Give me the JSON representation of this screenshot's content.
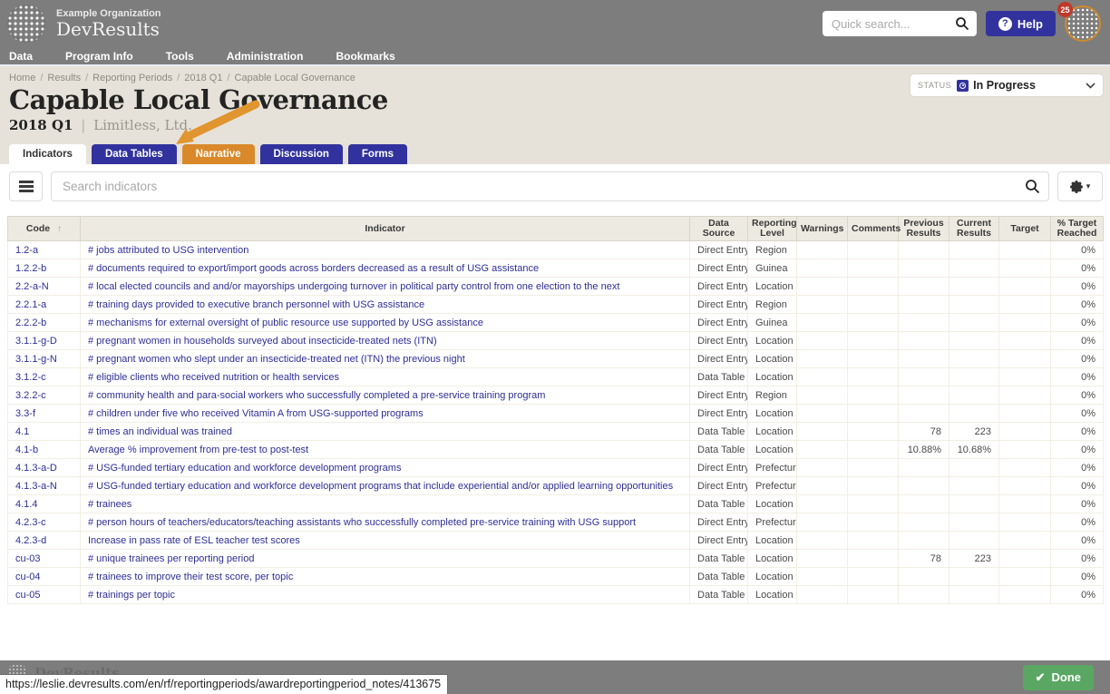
{
  "header": {
    "org_name": "Example Organization",
    "app_name": "DevResults",
    "quick_search_placeholder": "Quick search...",
    "help_label": "Help",
    "notification_count": "25"
  },
  "nav": {
    "items": [
      "Data",
      "Program Info",
      "Tools",
      "Administration",
      "Bookmarks"
    ]
  },
  "breadcrumb": {
    "items": [
      "Home",
      "Results",
      "Reporting Periods",
      "2018 Q1",
      "Capable Local Governance"
    ]
  },
  "page": {
    "title": "Capable Local Governance",
    "period": "2018 Q1",
    "partner": "Limitless, Ltd.",
    "status_label": "STATUS",
    "status_value": "In Progress"
  },
  "tabs": [
    {
      "label": "Indicators"
    },
    {
      "label": "Data Tables"
    },
    {
      "label": "Narrative"
    },
    {
      "label": "Discussion"
    },
    {
      "label": "Forms"
    }
  ],
  "toolbar": {
    "search_placeholder": "Search indicators"
  },
  "table": {
    "columns": [
      "Code",
      "Indicator",
      "Data Source",
      "Reporting Level",
      "Warnings",
      "Comments",
      "Previous Results",
      "Current Results",
      "Target",
      "% Target Reached"
    ],
    "rows": [
      {
        "code": "1.2-a",
        "indicator": "# jobs attributed to USG intervention",
        "data_source": "Direct Entry",
        "reporting_level": "Region",
        "warnings": "",
        "comments": "",
        "previous": "",
        "current": "",
        "target": "",
        "pct": "0%"
      },
      {
        "code": "1.2.2-b",
        "indicator": "# documents required to export/import goods across borders decreased as a result of USG assistance",
        "data_source": "Direct Entry",
        "reporting_level": "Guinea",
        "warnings": "",
        "comments": "",
        "previous": "",
        "current": "",
        "target": "",
        "pct": "0%"
      },
      {
        "code": "2.2-a-N",
        "indicator": "# local elected councils and and/or mayorships undergoing turnover in political party control from one election to the next",
        "data_source": "Direct Entry",
        "reporting_level": "Location",
        "warnings": "",
        "comments": "",
        "previous": "",
        "current": "",
        "target": "",
        "pct": "0%"
      },
      {
        "code": "2.2.1-a",
        "indicator": "# training days provided to executive branch personnel with USG assistance",
        "data_source": "Direct Entry",
        "reporting_level": "Region",
        "warnings": "",
        "comments": "",
        "previous": "",
        "current": "",
        "target": "",
        "pct": "0%"
      },
      {
        "code": "2.2.2-b",
        "indicator": "# mechanisms for external oversight of public resource use supported by USG assistance",
        "data_source": "Direct Entry",
        "reporting_level": "Guinea",
        "warnings": "",
        "comments": "",
        "previous": "",
        "current": "",
        "target": "",
        "pct": "0%"
      },
      {
        "code": "3.1.1-g-D",
        "indicator": "# pregnant women in households surveyed about insecticide-treated nets (ITN)",
        "data_source": "Direct Entry",
        "reporting_level": "Location",
        "warnings": "",
        "comments": "",
        "previous": "",
        "current": "",
        "target": "",
        "pct": "0%"
      },
      {
        "code": "3.1.1-g-N",
        "indicator": "# pregnant women who slept under an insecticide-treated net (ITN) the previous night",
        "data_source": "Direct Entry",
        "reporting_level": "Location",
        "warnings": "",
        "comments": "",
        "previous": "",
        "current": "",
        "target": "",
        "pct": "0%"
      },
      {
        "code": "3.1.2-c",
        "indicator": "# eligible clients who received nutrition or health services",
        "data_source": "Data Table",
        "reporting_level": "Location",
        "warnings": "",
        "comments": "",
        "previous": "",
        "current": "",
        "target": "",
        "pct": "0%"
      },
      {
        "code": "3.2.2-c",
        "indicator": "# community health and para-social workers who successfully completed a pre-service training program",
        "data_source": "Direct Entry",
        "reporting_level": "Region",
        "warnings": "",
        "comments": "",
        "previous": "",
        "current": "",
        "target": "",
        "pct": "0%"
      },
      {
        "code": "3.3-f",
        "indicator": "# children under five who received Vitamin A from USG-supported programs",
        "data_source": "Direct Entry",
        "reporting_level": "Location",
        "warnings": "",
        "comments": "",
        "previous": "",
        "current": "",
        "target": "",
        "pct": "0%"
      },
      {
        "code": "4.1",
        "indicator": "# times an individual was trained",
        "data_source": "Data Table",
        "reporting_level": "Location",
        "warnings": "",
        "comments": "",
        "previous": "78",
        "current": "223",
        "target": "",
        "pct": "0%"
      },
      {
        "code": "4.1-b",
        "indicator": "Average % improvement from pre-test to post-test",
        "data_source": "Data Table",
        "reporting_level": "Location",
        "warnings": "",
        "comments": "",
        "previous": "10.88%",
        "current": "10.68%",
        "target": "",
        "pct": "0%"
      },
      {
        "code": "4.1.3-a-D",
        "indicator": "# USG-funded tertiary education and workforce development programs",
        "data_source": "Direct Entry",
        "reporting_level": "Prefecture",
        "warnings": "",
        "comments": "",
        "previous": "",
        "current": "",
        "target": "",
        "pct": "0%"
      },
      {
        "code": "4.1.3-a-N",
        "indicator": "# USG-funded tertiary education and workforce development programs that include experiential and/or applied learning opportunities",
        "data_source": "Direct Entry",
        "reporting_level": "Prefecture",
        "warnings": "",
        "comments": "",
        "previous": "",
        "current": "",
        "target": "",
        "pct": "0%"
      },
      {
        "code": "4.1.4",
        "indicator": "# trainees",
        "data_source": "Data Table",
        "reporting_level": "Location",
        "warnings": "",
        "comments": "",
        "previous": "",
        "current": "",
        "target": "",
        "pct": "0%"
      },
      {
        "code": "4.2.3-c",
        "indicator": "# person hours of teachers/educators/teaching assistants who successfully completed pre-service training with USG support",
        "data_source": "Direct Entry",
        "reporting_level": "Prefecture",
        "warnings": "",
        "comments": "",
        "previous": "",
        "current": "",
        "target": "",
        "pct": "0%"
      },
      {
        "code": "4.2.3-d",
        "indicator": "Increase in pass rate of ESL teacher test scores",
        "data_source": "Direct Entry",
        "reporting_level": "Location",
        "warnings": "",
        "comments": "",
        "previous": "",
        "current": "",
        "target": "",
        "pct": "0%"
      },
      {
        "code": "cu-03",
        "indicator": "# unique trainees per reporting period",
        "data_source": "Data Table",
        "reporting_level": "Location",
        "warnings": "",
        "comments": "",
        "previous": "78",
        "current": "223",
        "target": "",
        "pct": "0%"
      },
      {
        "code": "cu-04",
        "indicator": "# trainees to improve their test score, per topic",
        "data_source": "Data Table",
        "reporting_level": "Location",
        "warnings": "",
        "comments": "",
        "previous": "",
        "current": "",
        "target": "",
        "pct": "0%"
      },
      {
        "code": "cu-05",
        "indicator": "# trainings per topic",
        "data_source": "Data Table",
        "reporting_level": "Location",
        "warnings": "",
        "comments": "",
        "previous": "",
        "current": "",
        "target": "",
        "pct": "0%"
      }
    ]
  },
  "footer": {
    "app_name": "DevResults",
    "done_label": "Done"
  },
  "status_bar": {
    "url": "https://leslie.devresults.com/en/rf/reportingperiods/awardreportingperiod_notes/413675"
  },
  "icons": {
    "check": "✔",
    "sort_asc": "↑",
    "caret_down": "▾",
    "chevron_down": "⌄"
  },
  "colors": {
    "header_gray": "#7d7d7d",
    "beige": "#e6e2d9",
    "indigo": "#32329e",
    "orange_tab": "#d9892a",
    "link": "#2e2e96",
    "done_green": "#5aa763",
    "badge_red": "#c0392b"
  }
}
